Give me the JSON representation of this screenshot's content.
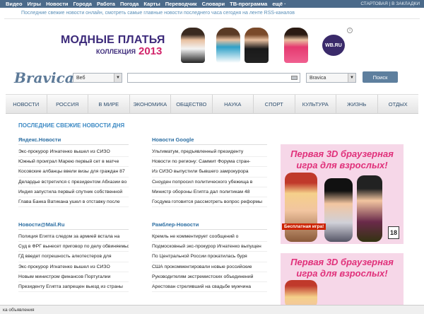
{
  "topbar": {
    "nav": [
      "Видео",
      "Игры",
      "Новости",
      "Города",
      "Работа",
      "Погода",
      "Карты",
      "Переводчик",
      "Словари",
      "ТВ-программа",
      "ещё ·"
    ],
    "right": "СТАРТОВАЯ | В ЗАКЛАДКИ"
  },
  "tagline": "Последние свежие новости онлайн, смотреть самые главные новости последнего часа сегодня на ленте RSS-каналов",
  "banner": {
    "line1": "МОДНЫЕ ПЛАТЬЯ",
    "line2": "КОЛЛЕКЦИЯ",
    "line3": "2013",
    "brand": "WB.RU"
  },
  "search": {
    "logo": "Bravica",
    "scope": "Веб",
    "engine": "Bravica",
    "button": "Поиск"
  },
  "categories": [
    "НОВОСТИ",
    "РОССИЯ",
    "В МИРЕ",
    "ЭКОНОМИКА",
    "ОБЩЕСТВО",
    "НАУКА",
    "СПОРТ",
    "КУЛЬТУРА",
    "ЖИЗНЬ",
    "ОТДЫХ"
  ],
  "section_title": "ПОСЛЕДНИЕ СВЕЖИЕ НОВОСТИ ДНЯ",
  "blocks": [
    {
      "title": "Яндекс.Новости",
      "items": [
        "Экс-прокурор Игнатенко вышел из СИЗО",
        "Южный проиграл Марею первый сет в матче",
        "Косовские албанцы ввели визы для граждан 87",
        "Делардье встретился с президентом Абхазии во",
        "Индия запустила первый спутник собственной",
        "Глава Банка Ватикана ушел в отставку после"
      ]
    },
    {
      "title": "Новости Google",
      "items": [
        "Ультиматум, предъявленный президенту",
        "Новости по региону: Саммит Форума стран-",
        "Из СИЗО выпустили бывшего замрокурора",
        "Сноуден попросил политического убежища в",
        "Министр обороны Египта дал политикам 48",
        "Госдума готовится рассмотреть вопрос реформы"
      ]
    },
    {
      "title": "Новости@Mail.Ru",
      "items": [
        "Полиция Египта следом за армией встала на",
        "Суд в ФРГ вынесет приговор по делу обвиняемых",
        "ГД введет погрешность алкотестеров для",
        "Экс-прокурор Игнатенко вышел из СИЗО",
        "Новым министром финансов Португалии",
        "Президенту Египта запрещен выезд из страны"
      ]
    },
    {
      "title": "Рамблер-Новости",
      "items": [
        "Кремль не комментирует сообщений о",
        "Подмосковный экс-прокурор Игнатенко выпущен",
        "По Центральной России прокатилась буря",
        "США прокомментировали новые российские",
        "Руководителям экстремистских объединений",
        "Арестован стрелявший на свадьбе мужчина"
      ]
    }
  ],
  "ads": [
    {
      "line1": "Первая 3D браузерная",
      "line2": "игра для взрослых!",
      "free": "Бесплатная игра!",
      "age": "18"
    },
    {
      "line1": "Первая 3D браузерная",
      "line2": "игра для взрослых!"
    }
  ],
  "status": "ка объявления"
}
